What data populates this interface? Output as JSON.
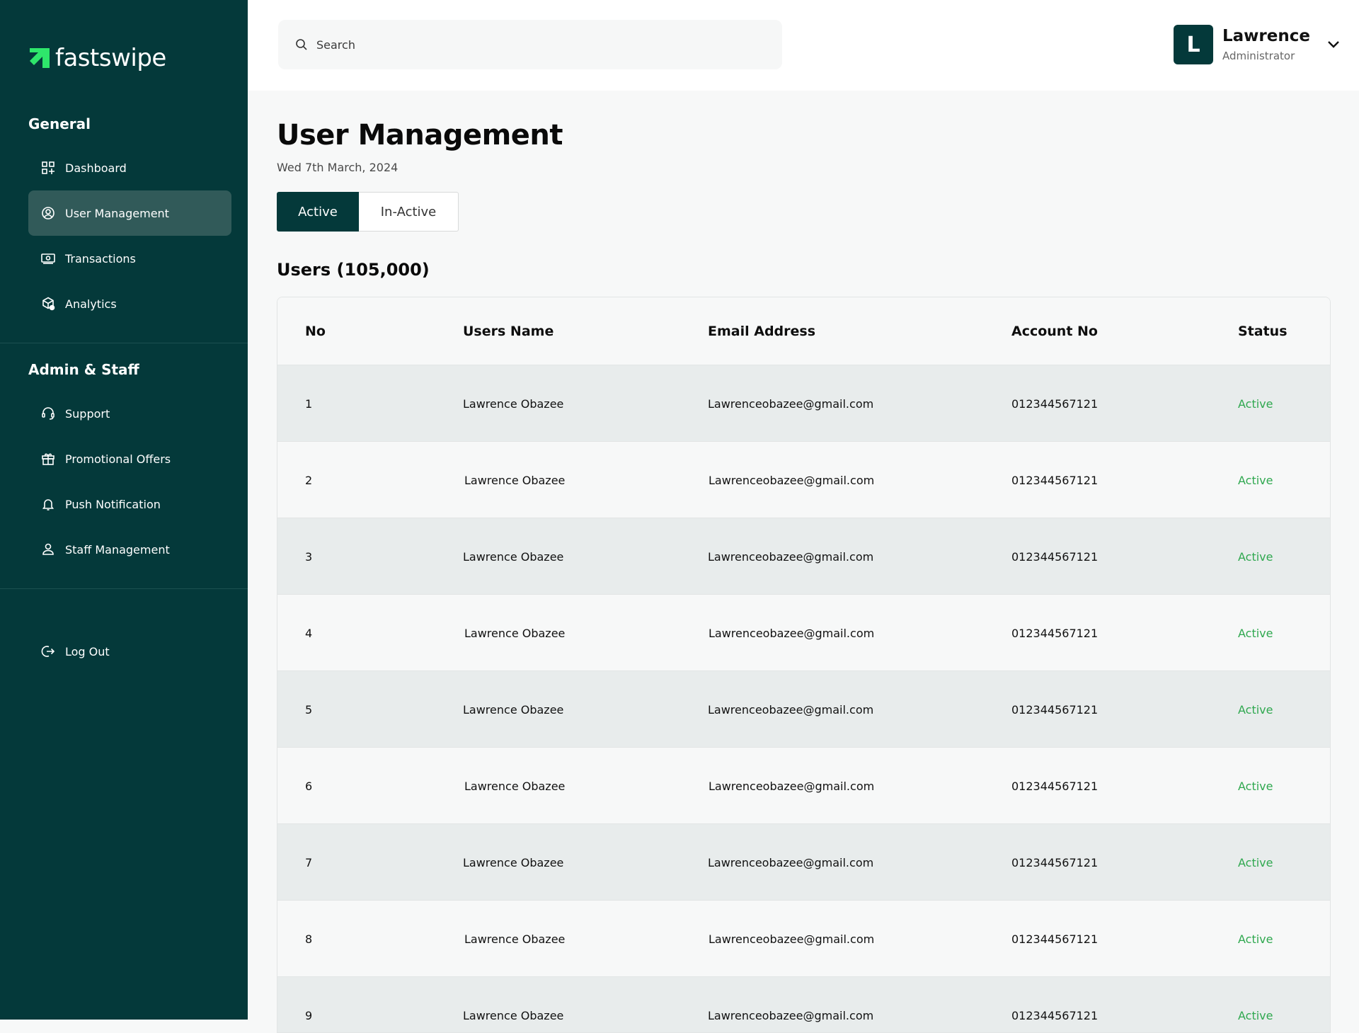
{
  "brand": {
    "name": "fastswipe",
    "accent": "#2ee66b"
  },
  "sidebar": {
    "sections": [
      {
        "title": "General",
        "items": [
          {
            "label": "Dashboard",
            "icon": "dashboard-icon"
          },
          {
            "label": "User Management",
            "icon": "user-circle-icon",
            "active": true
          },
          {
            "label": "Transactions",
            "icon": "money-icon"
          },
          {
            "label": "Analytics",
            "icon": "analytics-icon"
          }
        ]
      },
      {
        "title": "Admin & Staff",
        "items": [
          {
            "label": "Support",
            "icon": "headset-icon"
          },
          {
            "label": "Promotional Offers",
            "icon": "gift-icon"
          },
          {
            "label": "Push Notification",
            "icon": "bell-icon"
          },
          {
            "label": "Staff Management",
            "icon": "staff-icon"
          }
        ]
      }
    ],
    "logout": {
      "label": "Log Out",
      "icon": "logout-icon"
    }
  },
  "header": {
    "search_placeholder": "Search",
    "profile": {
      "initial": "L",
      "name": "Lawrence",
      "role": "Administrator"
    }
  },
  "main": {
    "title": "User Management",
    "date": "Wed 7th March, 2024",
    "tabs": [
      {
        "label": "Active",
        "selected": true
      },
      {
        "label": "In-Active",
        "selected": false
      }
    ],
    "users_count_label": "Users (105,000)"
  },
  "table": {
    "columns": [
      "No",
      "Users Name",
      "Email Address",
      "Account No",
      "Status"
    ],
    "rows": [
      {
        "no": "1",
        "name": "Lawrence Obazee",
        "email": "Lawrenceobazee@gmail.com",
        "account": "012344567121",
        "status": "Active"
      },
      {
        "no": "2",
        "name": "Lawrence Obazee",
        "email": "Lawrenceobazee@gmail.com",
        "account": "012344567121",
        "status": "Active"
      },
      {
        "no": "3",
        "name": "Lawrence Obazee",
        "email": "Lawrenceobazee@gmail.com",
        "account": "012344567121",
        "status": "Active"
      },
      {
        "no": "4",
        "name": "Lawrence Obazee",
        "email": "Lawrenceobazee@gmail.com",
        "account": "012344567121",
        "status": "Active"
      },
      {
        "no": "5",
        "name": "Lawrence Obazee",
        "email": "Lawrenceobazee@gmail.com",
        "account": "012344567121",
        "status": "Active"
      },
      {
        "no": "6",
        "name": "Lawrence Obazee",
        "email": "Lawrenceobazee@gmail.com",
        "account": "012344567121",
        "status": "Active"
      },
      {
        "no": "7",
        "name": "Lawrence Obazee",
        "email": "Lawrenceobazee@gmail.com",
        "account": "012344567121",
        "status": "Active"
      },
      {
        "no": "8",
        "name": "Lawrence Obazee",
        "email": "Lawrenceobazee@gmail.com",
        "account": "012344567121",
        "status": "Active"
      },
      {
        "no": "9",
        "name": "Lawrence Obazee",
        "email": "Lawrenceobazee@gmail.com",
        "account": "012344567121",
        "status": "Active"
      }
    ]
  },
  "colors": {
    "sidebar_bg": "#04393a",
    "sidebar_active": "#315a59",
    "status_active": "#2fa84f",
    "row_alt": "#e8ecec"
  }
}
